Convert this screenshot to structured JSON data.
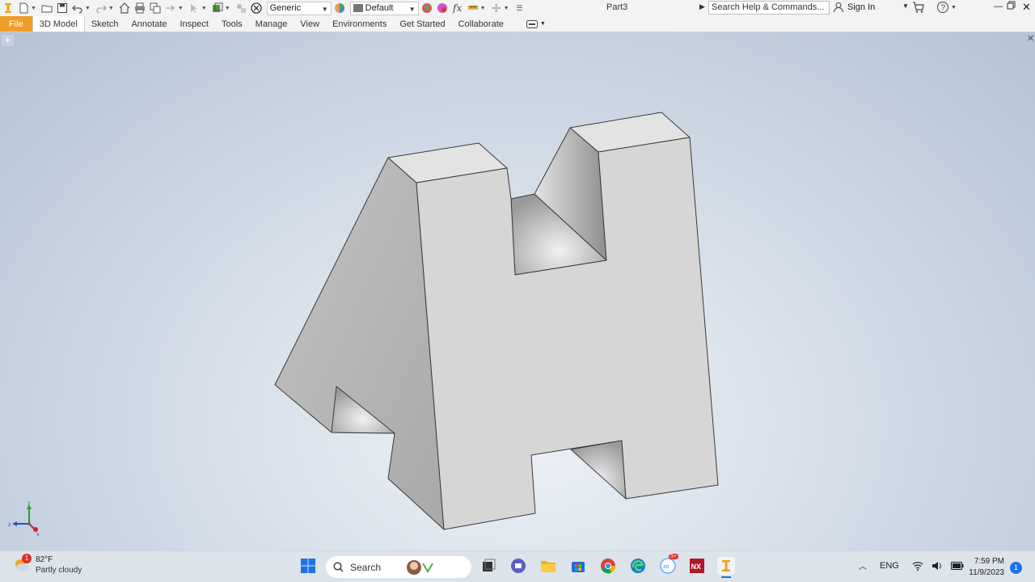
{
  "app": {
    "title": "Part3",
    "material_combo": "Generic",
    "appearance_combo": "Default",
    "search_placeholder": "Search Help & Commands...",
    "sign_in": "Sign In"
  },
  "ribbon_tabs": [
    {
      "label": "File"
    },
    {
      "label": "3D Model"
    },
    {
      "label": "Sketch"
    },
    {
      "label": "Annotate"
    },
    {
      "label": "Inspect"
    },
    {
      "label": "Tools"
    },
    {
      "label": "Manage"
    },
    {
      "label": "View"
    },
    {
      "label": "Environments"
    },
    {
      "label": "Get Started"
    },
    {
      "label": "Collaborate"
    }
  ],
  "viewcube_triad": {
    "x_label": "x",
    "y_label": "y",
    "z_label": "z"
  },
  "taskbar": {
    "weather_temp": "82°F",
    "weather_condition": "Partly cloudy",
    "weather_badge": "1",
    "search_label": "Search",
    "language": "ENG",
    "time": "7:59 PM",
    "date": "11/9/2023",
    "notification_count": "1",
    "zoom_badge": "5+"
  },
  "colors": {
    "file_tab": "#f09d26",
    "accent": "#1a73e8"
  }
}
